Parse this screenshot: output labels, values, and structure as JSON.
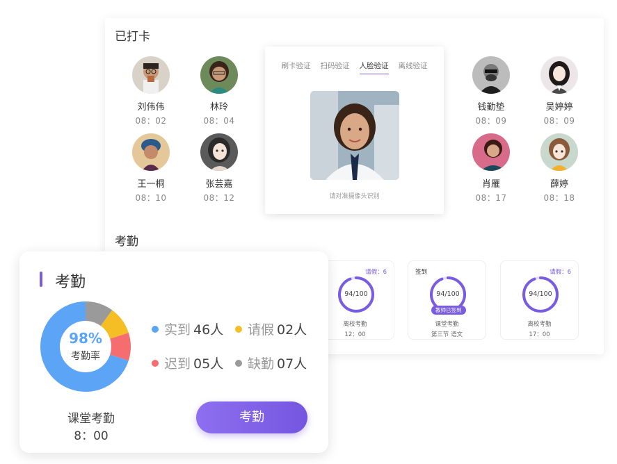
{
  "checked_in": {
    "title": "已打卡",
    "people": [
      {
        "name": "刘伟伟",
        "time": "08：02"
      },
      {
        "name": "林玲",
        "time": "08：04"
      },
      {
        "name": "王一桐",
        "time": "08：10"
      },
      {
        "name": "张芸嘉",
        "time": "08：12"
      },
      {
        "name": "钱勤垫",
        "time": "08：09"
      },
      {
        "name": "吴婷婷",
        "time": "08：09"
      },
      {
        "name": "肖雁",
        "time": "08：17"
      },
      {
        "name": "薛婷",
        "time": "08：18"
      }
    ]
  },
  "verify": {
    "tabs": [
      "刷卡验证",
      "扫码验证",
      "人脸验证",
      "离线验证"
    ],
    "active_tab": "人脸验证",
    "hint": "请对准摄像头识别"
  },
  "attendance_section": {
    "title": "考勤",
    "cards": [
      {
        "score": "94/100",
        "top_right": "请假：6",
        "label": "离校考勤",
        "sub": "12：00",
        "progress": 0.94
      },
      {
        "score": "94/100",
        "top_left": "签到",
        "badge": "教师已签到",
        "label": "课堂考勤",
        "sub": "第三节  语文",
        "progress": 0.94
      },
      {
        "score": "94/100",
        "top_right": "请假：6",
        "label": "离校考勤",
        "sub": "17：00",
        "progress": 0.94
      }
    ]
  },
  "summary": {
    "title": "考勤",
    "rate_value": "98%",
    "rate_label": "考勤率",
    "legend": [
      {
        "label": "实到",
        "value": "46人",
        "color": "#5ba4f6"
      },
      {
        "label": "请假",
        "value": "02人",
        "color": "#f5be25"
      },
      {
        "label": "迟到",
        "value": "05人",
        "color": "#f56d6f"
      },
      {
        "label": "缺勤",
        "value": "07人",
        "color": "#9a9a9a"
      }
    ],
    "donut_fractions": [
      0.7,
      0.1,
      0.1,
      0.1
    ],
    "class_label": "课堂考勤",
    "class_time": "8：00",
    "button": "考勤"
  }
}
